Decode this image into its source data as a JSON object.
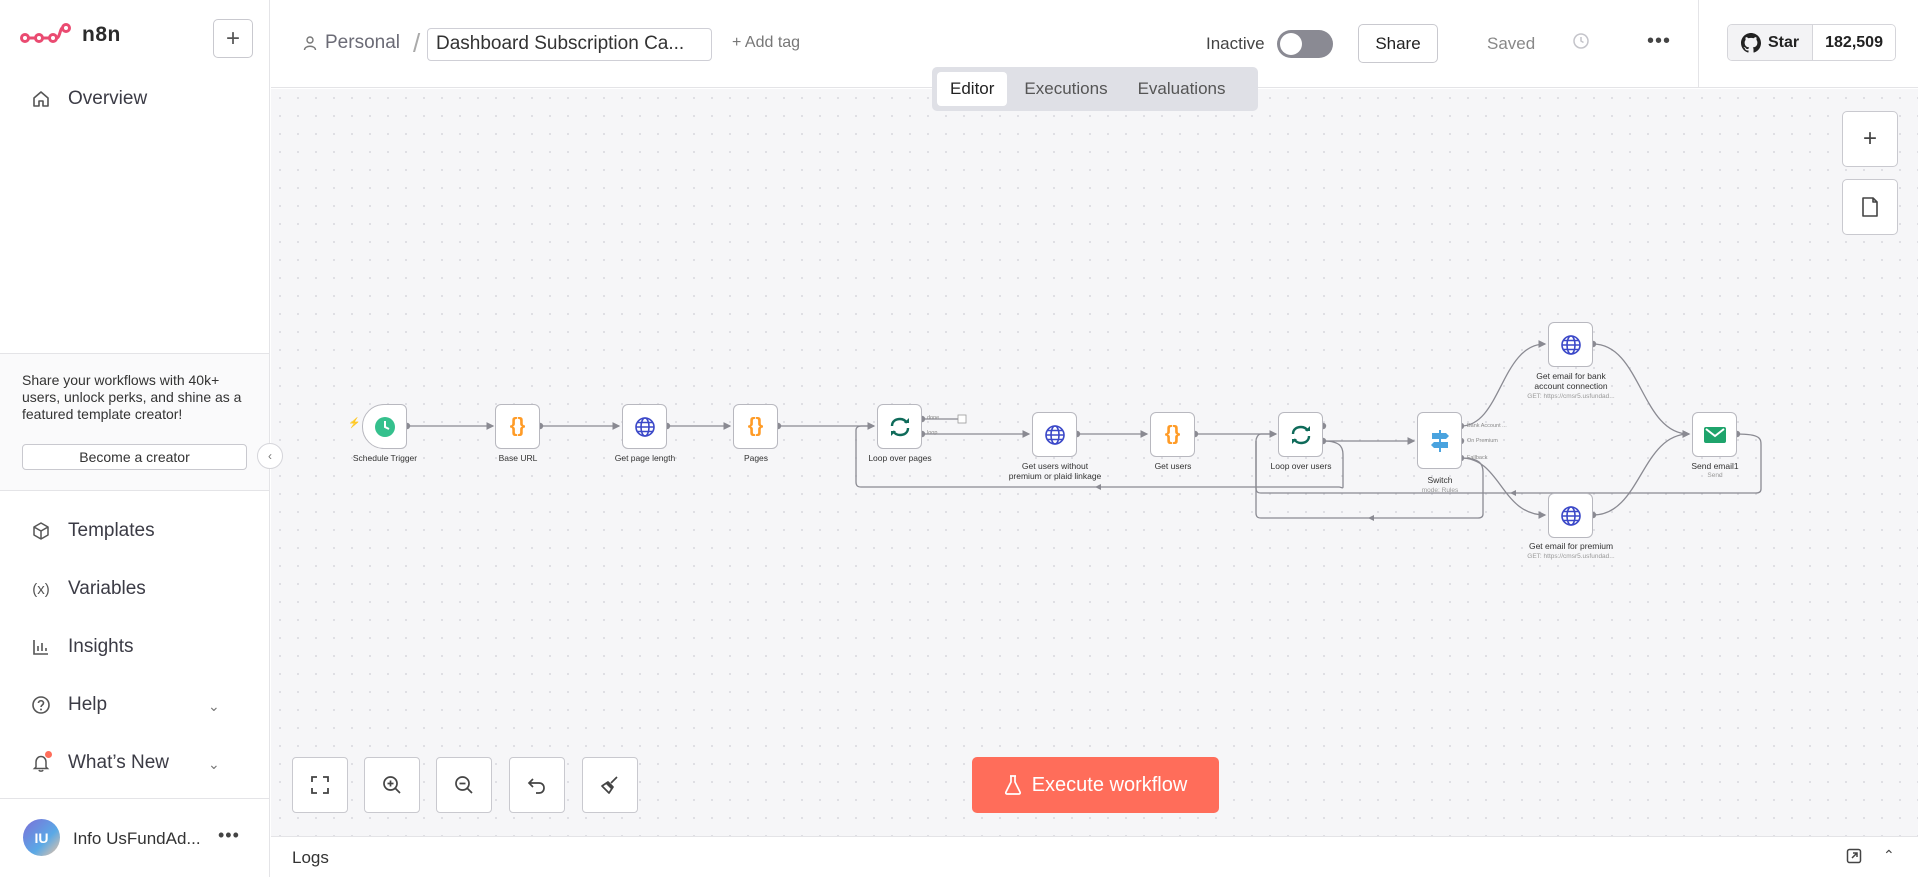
{
  "app": {
    "logo_text": "n8n"
  },
  "sidebar": {
    "overview": "Overview",
    "promo_text": "Share your workflows with 40k+ users, unlock perks, and shine as a featured template creator!",
    "promo_button": "Become a creator",
    "items": [
      {
        "label": "Templates",
        "icon": "box-icon"
      },
      {
        "label": "Variables",
        "icon": "variable-icon"
      },
      {
        "label": "Insights",
        "icon": "chart-icon"
      },
      {
        "label": "Help",
        "icon": "help-icon"
      },
      {
        "label": "What’s New",
        "icon": "bell-icon"
      }
    ],
    "user": {
      "initials": "IU",
      "name": "Info UsFundAd..."
    }
  },
  "header": {
    "project": "Personal",
    "workflow_name": "Dashboard Subscription Ca...",
    "add_tag": "+ Add tag",
    "status_label": "Inactive",
    "active": false,
    "share": "Share",
    "saved": "Saved",
    "github_star": "Star",
    "github_count": "182,509"
  },
  "tabs": [
    {
      "label": "Editor",
      "active": true
    },
    {
      "label": "Executions",
      "active": false
    },
    {
      "label": "Evaluations",
      "active": false
    }
  ],
  "canvas": {
    "execute_button": "Execute workflow",
    "nodes": [
      {
        "id": "schedule",
        "label": "Schedule Trigger",
        "sub": "",
        "icon": "clock"
      },
      {
        "id": "baseurl",
        "label": "Base URL",
        "sub": "",
        "icon": "code"
      },
      {
        "id": "pagelen",
        "label": "Get page length",
        "sub": "",
        "icon": "globe"
      },
      {
        "id": "pages",
        "label": "Pages",
        "sub": "",
        "icon": "code"
      },
      {
        "id": "looppages",
        "label": "Loop over pages",
        "sub": "",
        "icon": "loop"
      },
      {
        "id": "getusersnp",
        "label": "Get users without premium or plaid linkage",
        "sub": "",
        "icon": "globe"
      },
      {
        "id": "getusers",
        "label": "Get users",
        "sub": "",
        "icon": "code"
      },
      {
        "id": "loopusers",
        "label": "Loop over users",
        "sub": "",
        "icon": "loop"
      },
      {
        "id": "switch",
        "label": "Switch",
        "sub": "mode: Rules",
        "icon": "switch"
      },
      {
        "id": "emailbank",
        "label": "Get email for bank account connection",
        "sub": "GET: https://cmsr5.usfundad...",
        "icon": "globe"
      },
      {
        "id": "emailpremium",
        "label": "Get email for premium",
        "sub": "GET: https://cmsr5.usfundad...",
        "icon": "globe"
      },
      {
        "id": "sendemail",
        "label": "Send email1",
        "sub": "Send",
        "icon": "mail"
      }
    ],
    "output_labels": {
      "loop_done": "done",
      "loop_loop": "loop",
      "switch_bank": "Bank Account ...",
      "switch_premium": "On Premium",
      "switch_fallback": "Fallback"
    }
  },
  "logs": {
    "title": "Logs"
  },
  "colors": {
    "accent": "#ff6d5a",
    "trigger_green": "#35c08d",
    "code_orange": "#ff9b26",
    "globe_blue": "#3b48c8",
    "loop_teal": "#0f6b5a",
    "switch_blue": "#4aa3df"
  }
}
